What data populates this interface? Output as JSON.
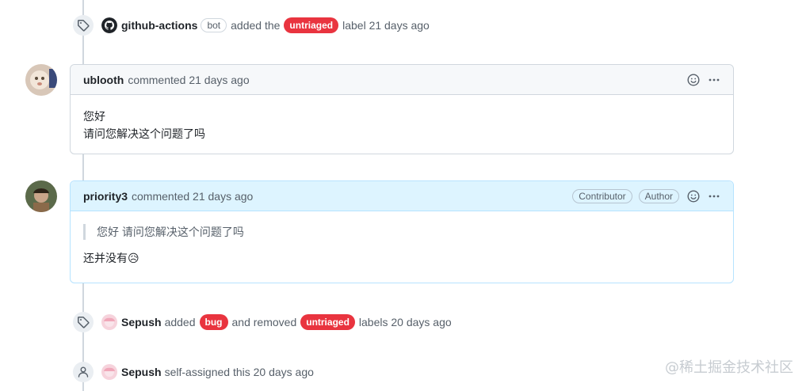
{
  "events": [
    {
      "actor": "github-actions",
      "bot_badge": "bot",
      "text_before": "added the",
      "label": "untriaged",
      "text_after": "label 21 days ago"
    },
    {
      "actor": "Sepush",
      "text_before": "added",
      "label1": "bug",
      "text_mid": "and removed",
      "label2": "untriaged",
      "text_after": "labels 20 days ago"
    },
    {
      "actor": "Sepush",
      "text": "self-assigned this 20 days ago"
    }
  ],
  "comments": [
    {
      "author": "ublooth",
      "meta": "commented 21 days ago",
      "body_lines": [
        "您好",
        "请问您解决这个问题了吗"
      ]
    },
    {
      "author": "priority3",
      "meta": "commented 21 days ago",
      "badges": [
        "Contributor",
        "Author"
      ],
      "quote": "您好 请问您解决这个问题了吗",
      "reply": "还并没有",
      "reply_emoji": "😥"
    }
  ],
  "colors": {
    "label_red": "#e9343f",
    "author_header": "#ddf4ff",
    "timeline": "#d0d7de"
  },
  "icons": [
    "tag-icon",
    "github-logo-icon",
    "smiley-icon",
    "kebab-horizontal-icon",
    "person-icon"
  ],
  "watermark": "@稀土掘金技术社区"
}
